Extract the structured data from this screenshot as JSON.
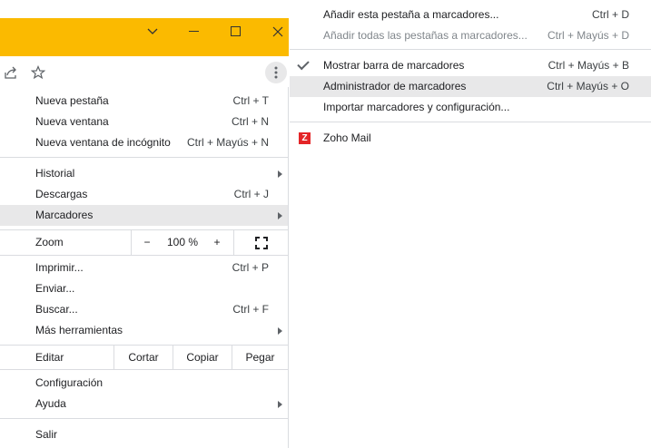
{
  "main_menu": {
    "new_tab": {
      "label": "Nueva pestaña",
      "shortcut": "Ctrl + T"
    },
    "new_window": {
      "label": "Nueva ventana",
      "shortcut": "Ctrl + N"
    },
    "incognito": {
      "label": "Nueva ventana de incógnito",
      "shortcut": "Ctrl + Mayús + N"
    },
    "history": {
      "label": "Historial"
    },
    "downloads": {
      "label": "Descargas",
      "shortcut": "Ctrl + J"
    },
    "bookmarks": {
      "label": "Marcadores"
    },
    "zoom": {
      "label": "Zoom",
      "minus": "−",
      "value": "100 %",
      "plus": "+"
    },
    "print": {
      "label": "Imprimir...",
      "shortcut": "Ctrl + P"
    },
    "cast": {
      "label": "Enviar..."
    },
    "find": {
      "label": "Buscar...",
      "shortcut": "Ctrl + F"
    },
    "more_tools": {
      "label": "Más herramientas"
    },
    "edit": {
      "label": "Editar",
      "cut": "Cortar",
      "copy": "Copiar",
      "paste": "Pegar"
    },
    "settings": {
      "label": "Configuración"
    },
    "help": {
      "label": "Ayuda"
    },
    "exit": {
      "label": "Salir"
    }
  },
  "bookmarks_submenu": {
    "add_tab": {
      "label": "Añadir esta pestaña a marcadores...",
      "shortcut": "Ctrl + D"
    },
    "add_all_tabs": {
      "label": "Añadir todas las pestañas a marcadores...",
      "shortcut": "Ctrl + Mayús + D"
    },
    "show_bar": {
      "label": "Mostrar barra de marcadores",
      "shortcut": "Ctrl + Mayús + B"
    },
    "manager": {
      "label": "Administrador de marcadores",
      "shortcut": "Ctrl + Mayús + O"
    },
    "import": {
      "label": "Importar marcadores y configuración..."
    },
    "zoho": {
      "label": "Zoho Mail",
      "icon_letter": "Z"
    }
  },
  "colors": {
    "titlebar": "#fbba00",
    "highlight": "#e8e8e9",
    "zoho": "#e42527"
  }
}
